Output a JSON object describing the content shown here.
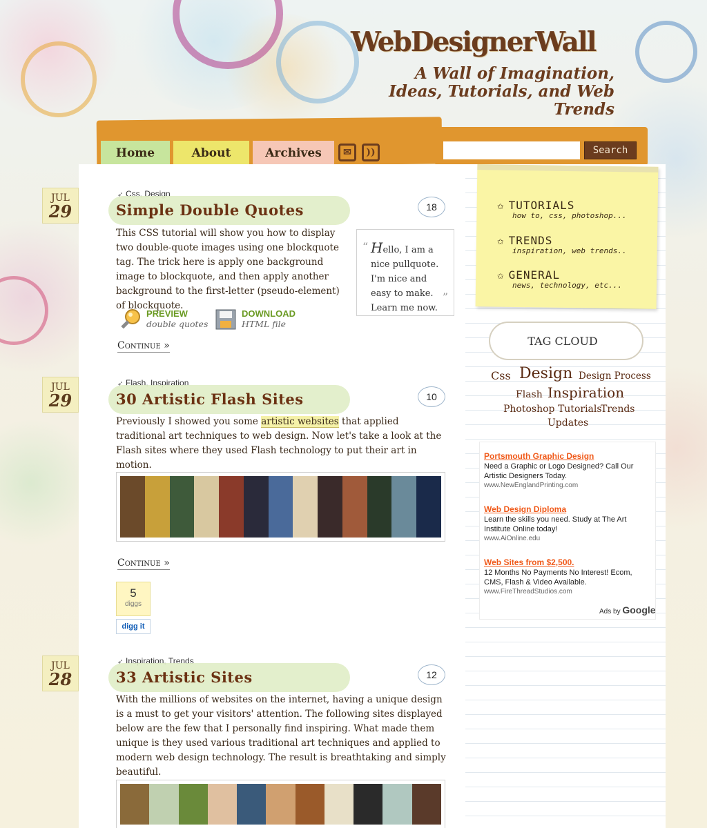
{
  "site": {
    "title": "WebDesignerWall",
    "tagline": "A Wall of Imagination, Ideas, Tutorials, and Web Trends"
  },
  "nav": {
    "tabs": [
      {
        "label": "Home"
      },
      {
        "label": "About"
      },
      {
        "label": "Archives"
      }
    ],
    "icons": [
      "mail-icon",
      "rss-icon"
    ],
    "search_placeholder": "",
    "search_button": "Search"
  },
  "posts": [
    {
      "date_month": "JUL",
      "date_day": "29",
      "categories": "Css, Design",
      "title": "Simple Double Quotes",
      "comments": "18",
      "body": "This CSS tutorial will show you how to display two double-quote images using one blockquote tag. The trick here is apply one background image to blockquote, and then apply another background to the first-letter (pseudo-element) of blockquote.",
      "pullquote_first": "H",
      "pullquote_rest": "ello, I am a nice pullquote. I'm nice and easy to make. Learn me now.",
      "preview_label": "PREVIEW",
      "preview_sub": "double quotes",
      "download_label": "DOWNLOAD",
      "download_sub": "HTML file",
      "continue": "Continue »"
    },
    {
      "date_month": "JUL",
      "date_day": "29",
      "categories": "Flash, Inspiration",
      "title": "30 Artistic Flash Sites",
      "comments": "10",
      "body_pre": "Previously I showed you some ",
      "body_link": "artistic websites",
      "body_post": " that applied traditional art techniques to web design. Now let's take a look at the Flash sites where they used Flash technology to put their art in motion.",
      "continue": "Continue »",
      "digg_count": "5",
      "digg_label": "diggs",
      "digg_button": "digg it"
    },
    {
      "date_month": "JUL",
      "date_day": "28",
      "categories": "Inspiration, Trends",
      "title": "33 Artistic Sites",
      "comments": "12",
      "body": "With the millions of websites on the internet, having a unique design is a must to get your visitors' attention. The following sites displayed below are the few that I personally find inspiring. What made them unique is they used various traditional art techniques and applied to modern web design technology. The result is breathtaking and simply beautiful."
    }
  ],
  "sidebar": {
    "categories": [
      {
        "name": "TUTORIALS",
        "sub": "how to, css, photoshop..."
      },
      {
        "name": "TRENDS",
        "sub": "inspiration, web trends.."
      },
      {
        "name": "GENERAL",
        "sub": "news, technology, etc..."
      }
    ],
    "tagcloud_title": "TAG CLOUD",
    "tags": [
      "Css",
      "Design",
      "Design Process",
      "Flash",
      "Inspiration",
      "Photoshop Tutorials",
      "Trends",
      "Updates"
    ],
    "ads": [
      {
        "title": "Portsmouth Graphic Design",
        "text": "Need a Graphic or Logo Designed? Call Our Artistic Designers Today.",
        "url": "www.NewEnglandPrinting.com"
      },
      {
        "title": "Web Design Diploma",
        "text": "Learn the skills you need. Study at The Art Institute Online today!",
        "url": "www.AiOnline.edu"
      },
      {
        "title": "Web Sites from $2,500.",
        "text": "12 Months No Payments No Interest! Ecom, CMS, Flash & Video Available.",
        "url": "www.FireThreadStudios.com"
      }
    ],
    "ads_by": "Ads by",
    "ads_google": "Google"
  },
  "colors": {
    "accent": "#6b3112",
    "nav_bar": "#e0962f",
    "home_tab": "#c7e59d",
    "about_tab": "#ede66b",
    "archives_tab": "#f6c7b6",
    "ad_link": "#f05a1a"
  }
}
